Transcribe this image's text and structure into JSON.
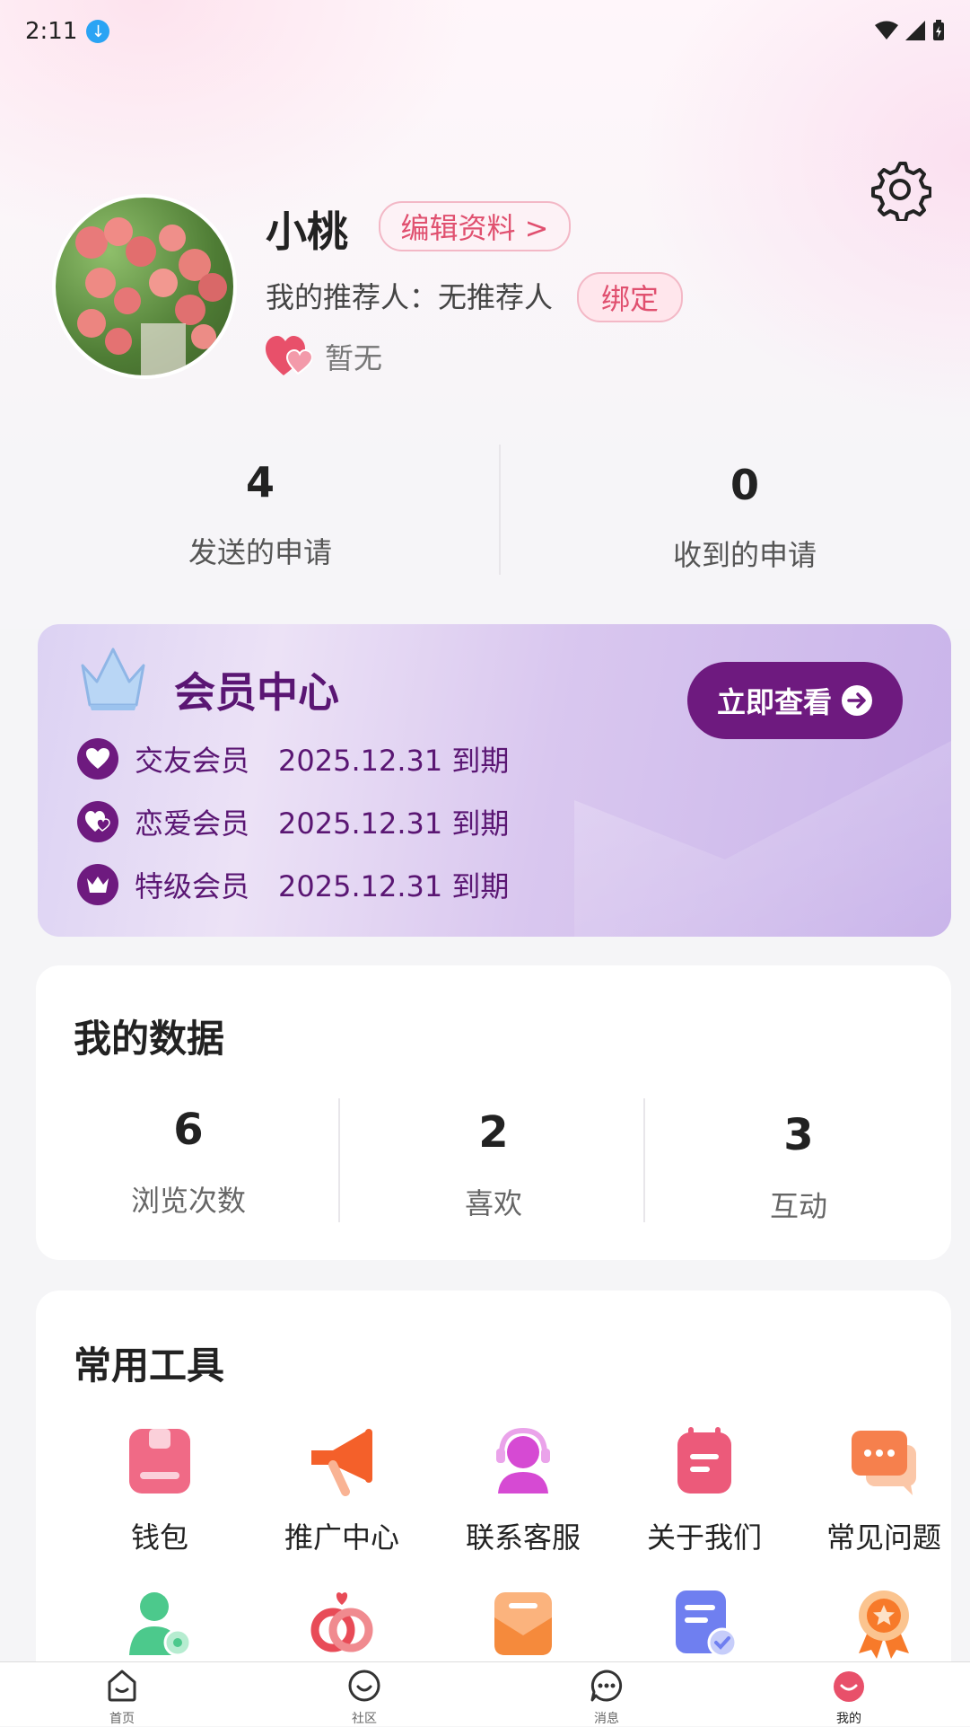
{
  "status_bar": {
    "time": "2:11"
  },
  "profile": {
    "name": "小桃",
    "edit_label": "编辑资料 >",
    "referrer_label": "我的推荐人：无推荐人",
    "bind_label": "绑定",
    "status_text": "暂无"
  },
  "applications": {
    "sent": {
      "value": "4",
      "label": "发送的申请"
    },
    "received": {
      "value": "0",
      "label": "收到的申请"
    }
  },
  "vip": {
    "title": "会员中心",
    "button_label": "立即查看",
    "memberships": [
      {
        "name": "交友会员",
        "expiry": "2025.12.31  到期"
      },
      {
        "name": "恋爱会员",
        "expiry": "2025.12.31  到期"
      },
      {
        "name": "特级会员",
        "expiry": "2025.12.31  到期"
      }
    ]
  },
  "my_data": {
    "title": "我的数据",
    "items": [
      {
        "value": "6",
        "label": "浏览次数"
      },
      {
        "value": "2",
        "label": "喜欢"
      },
      {
        "value": "3",
        "label": "互动"
      }
    ]
  },
  "tools": {
    "title": "常用工具",
    "items": [
      {
        "label": "钱包",
        "icon": "wallet-icon"
      },
      {
        "label": "推广中心",
        "icon": "megaphone-icon"
      },
      {
        "label": "联系客服",
        "icon": "customer-service-icon"
      },
      {
        "label": "关于我们",
        "icon": "notepad-icon"
      },
      {
        "label": "常见问题",
        "icon": "chat-bubbles-icon"
      }
    ]
  },
  "tabbar": {
    "items": [
      {
        "label": "首页",
        "icon": "home-icon"
      },
      {
        "label": "社区",
        "icon": "community-icon"
      },
      {
        "label": "消息",
        "icon": "message-icon"
      },
      {
        "label": "我的",
        "icon": "profile-icon"
      }
    ]
  },
  "colors": {
    "accent": "#e0506f",
    "vip_purple": "#6e1a7f"
  }
}
